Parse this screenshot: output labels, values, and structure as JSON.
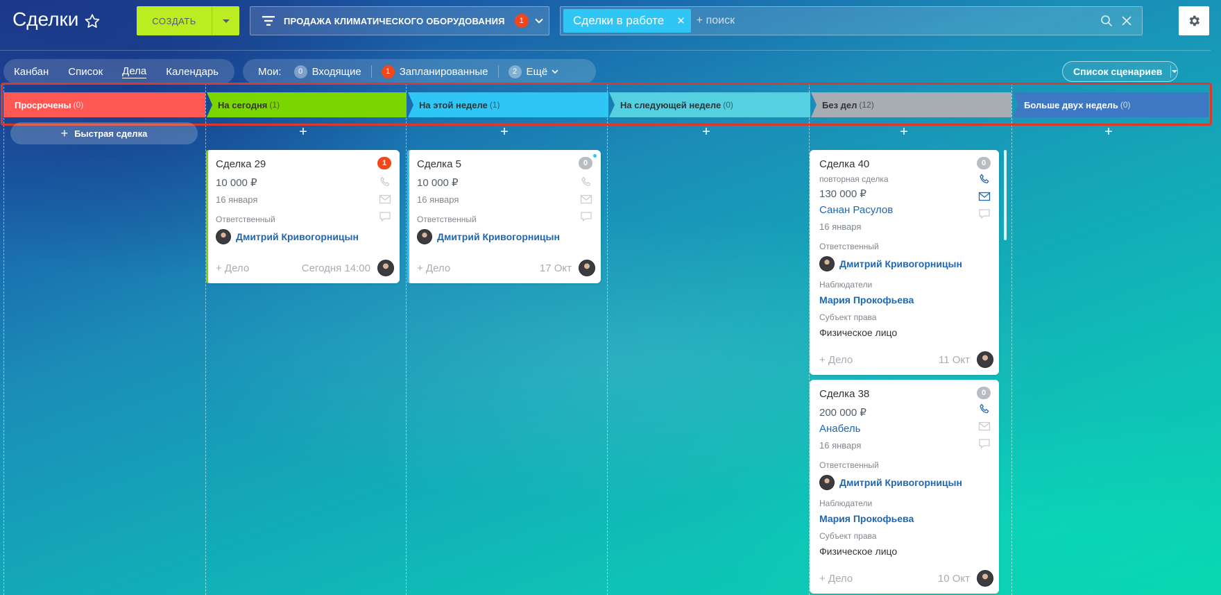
{
  "header": {
    "title": "Сделки",
    "create_label": "СОЗДАТЬ",
    "pipeline_label": "ПРОДАЖА КЛИМАТИЧЕСКОГО ОБОРУДОВАНИЯ",
    "pipeline_badge": "1",
    "filter_chip": "Сделки в работе",
    "search_placeholder": "+ поиск"
  },
  "views": {
    "items": [
      "Канбан",
      "Список",
      "Дела",
      "Календарь"
    ],
    "active": "Дела"
  },
  "my_filter": {
    "label": "Мои:",
    "incoming_count": "0",
    "incoming_label": "Входящие",
    "planned_count": "1",
    "planned_label": "Запланированные",
    "more_count": "2",
    "more_label": "Ещё"
  },
  "scenarios_label": "Список сценариев",
  "quick_deal_label": "Быстрая сделка",
  "stages": [
    {
      "name": "Просрочены",
      "count": "(0)",
      "color": "#ff5752"
    },
    {
      "name": "На сегодня",
      "count": "(1)",
      "color": "#7bd500"
    },
    {
      "name": "На этой неделе",
      "count": "(1)",
      "color": "#2fc6f6"
    },
    {
      "name": "На следующей неделе",
      "count": "(0)",
      "color": "#55d0e0"
    },
    {
      "name": "Без дел",
      "count": "(12)",
      "color": "#a8adb4"
    },
    {
      "name": "Больше двух недель",
      "count": "(0)",
      "color": "#3e77c4"
    }
  ],
  "cards": [
    {
      "title": "Сделка 29",
      "badge": "1",
      "amount": "10 000 ₽",
      "date": "16 января",
      "responsible_label": "Ответственный",
      "responsible": "Дмитрий Кривогорницын",
      "add_task": "+ Дело",
      "time": "Сегодня 14:00"
    },
    {
      "title": "Сделка 5",
      "badge": "0",
      "amount": "10 000 ₽",
      "date": "16 января",
      "responsible_label": "Ответственный",
      "responsible": "Дмитрий Кривогорницын",
      "add_task": "+ Дело",
      "time": "17 Окт"
    },
    {
      "title": "Сделка 40",
      "badge": "0",
      "subtitle": "повторная сделка",
      "amount": "130 000 ₽",
      "client": "Санан Расулов",
      "date": "16 января",
      "responsible_label": "Ответственный",
      "responsible": "Дмитрий Кривогорницын",
      "observers_label": "Наблюдатели",
      "observer": "Мария Прокофьева",
      "subject_label": "Субъект права",
      "subject": "Физическое лицо",
      "add_task": "+ Дело",
      "time": "11 Окт"
    },
    {
      "title": "Сделка 38",
      "badge": "0",
      "amount": "200 000 ₽",
      "client": "Анабель",
      "date": "16 января",
      "responsible_label": "Ответственный",
      "responsible": "Дмитрий Кривогорницын",
      "observers_label": "Наблюдатели",
      "observer": "Мария Прокофьева",
      "subject_label": "Субъект права",
      "subject": "Физическое лицо",
      "add_task": "+ Дело",
      "time": "10 Окт"
    }
  ]
}
